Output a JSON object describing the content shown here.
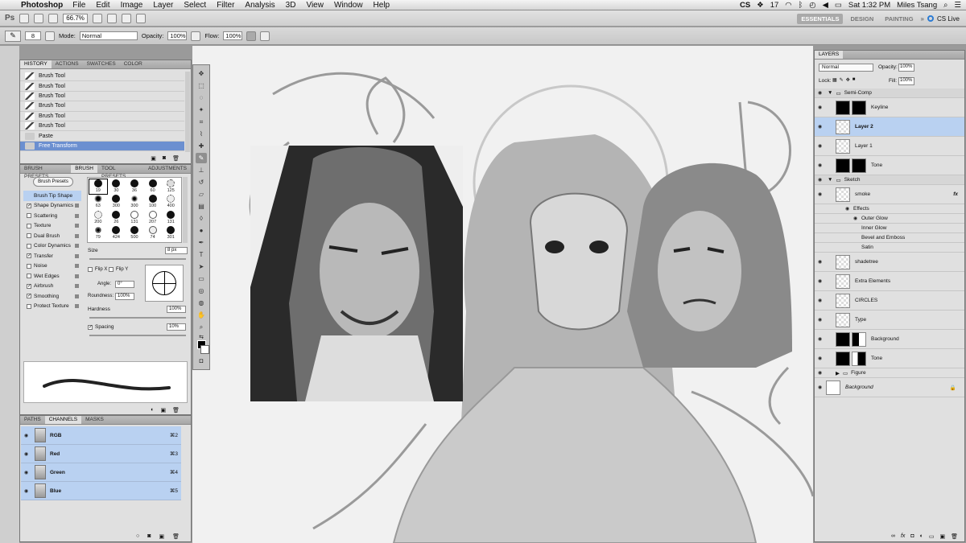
{
  "menubar": {
    "app": "Photoshop",
    "items": [
      "File",
      "Edit",
      "Image",
      "Layer",
      "Select",
      "Filter",
      "Analysis",
      "3D",
      "View",
      "Window",
      "Help"
    ],
    "status": {
      "adobe": "CS",
      "badge": "17",
      "clock": "Sat 1:32 PM",
      "user": "Miles Tsang"
    }
  },
  "app_bar": {
    "zoom": "66.7%",
    "workspaces": [
      "ESSENTIALS",
      "DESIGN",
      "PAINTING"
    ],
    "cslive": "CS Live"
  },
  "options": {
    "brush_size": "8",
    "mode_label": "Mode:",
    "mode_value": "Normal",
    "opacity_label": "Opacity:",
    "opacity_value": "100%",
    "flow_label": "Flow:",
    "flow_value": "100%"
  },
  "history_panel": {
    "tabs": [
      "HISTORY",
      "ACTIONS",
      "SWATCHES",
      "COLOR"
    ],
    "rows": [
      "Brush Tool",
      "Brush Tool",
      "Brush Tool",
      "Brush Tool",
      "Brush Tool",
      "Brush Tool",
      "Paste",
      "Free Transform"
    ]
  },
  "brush_panel": {
    "tabs": [
      "BRUSH PRESETS",
      "BRUSH",
      "TOOL PRESETS",
      "ADJUSTMENTS"
    ],
    "presets_button": "Brush Presets",
    "options": [
      {
        "label": "Brush Tip Shape",
        "checked": null
      },
      {
        "label": "Shape Dynamics",
        "checked": true
      },
      {
        "label": "Scattering",
        "checked": false
      },
      {
        "label": "Texture",
        "checked": false
      },
      {
        "label": "Dual Brush",
        "checked": false
      },
      {
        "label": "Color Dynamics",
        "checked": false
      },
      {
        "label": "Transfer",
        "checked": true
      },
      {
        "label": "Noise",
        "checked": false
      },
      {
        "label": "Wet Edges",
        "checked": false
      },
      {
        "label": "Airbrush",
        "checked": true
      },
      {
        "label": "Smoothing",
        "checked": true
      },
      {
        "label": "Protect Texture",
        "checked": false
      }
    ],
    "tips": [
      "19",
      "30",
      "36",
      "60",
      "125",
      "63",
      "300",
      "300",
      "100",
      "400",
      "200",
      "26",
      "131",
      "207",
      "131",
      "79",
      "424",
      "500",
      "74",
      "301"
    ],
    "size_label": "Size",
    "size_value": "8 px",
    "flipx": "Flip X",
    "flipy": "Flip Y",
    "angle_label": "Angle:",
    "angle_value": "0°",
    "roundness_label": "Roundness:",
    "roundness_value": "100%",
    "hardness_label": "Hardness",
    "hardness_value": "100%",
    "spacing_label": "Spacing",
    "spacing_value": "10%"
  },
  "channels_panel": {
    "tabs": [
      "PATHS",
      "CHANNELS",
      "MASKS"
    ],
    "rows": [
      {
        "name": "RGB",
        "shortcut": "⌘2"
      },
      {
        "name": "Red",
        "shortcut": "⌘3"
      },
      {
        "name": "Green",
        "shortcut": "⌘4"
      },
      {
        "name": "Blue",
        "shortcut": "⌘5"
      }
    ]
  },
  "layers_panel": {
    "title": "LAYERS",
    "blend": "Normal",
    "opacity_label": "Opacity:",
    "opacity_value": "100%",
    "lock_label": "Lock:",
    "fill_label": "Fill:",
    "fill_value": "100%",
    "rows": [
      {
        "name": "Semi-Comp",
        "kind": "group"
      },
      {
        "name": "Keyline",
        "kind": "mask"
      },
      {
        "name": "Layer 2",
        "kind": "layer",
        "selected": true
      },
      {
        "name": "Layer 1",
        "kind": "layer"
      },
      {
        "name": "Tone",
        "kind": "mask"
      },
      {
        "name": "Sketch",
        "kind": "group"
      },
      {
        "name": "smoke",
        "kind": "layer",
        "fx": "fx"
      },
      {
        "name": "Effects",
        "kind": "effect"
      },
      {
        "name": "Outer Glow",
        "kind": "effect-item",
        "visible": true
      },
      {
        "name": "Inner Glow",
        "kind": "effect-item"
      },
      {
        "name": "Bevel and Emboss",
        "kind": "effect-item"
      },
      {
        "name": "Satin",
        "kind": "effect-item"
      },
      {
        "name": "shadetree",
        "kind": "layer"
      },
      {
        "name": "Extra Elements",
        "kind": "layer"
      },
      {
        "name": "CIRCLES",
        "kind": "layer"
      },
      {
        "name": "Type",
        "kind": "layer"
      },
      {
        "name": "Background",
        "kind": "mask-photo"
      },
      {
        "name": "Tone",
        "kind": "mask-photo"
      },
      {
        "name": "Figure",
        "kind": "group-collapsed"
      },
      {
        "name": "Background",
        "kind": "background"
      }
    ]
  }
}
